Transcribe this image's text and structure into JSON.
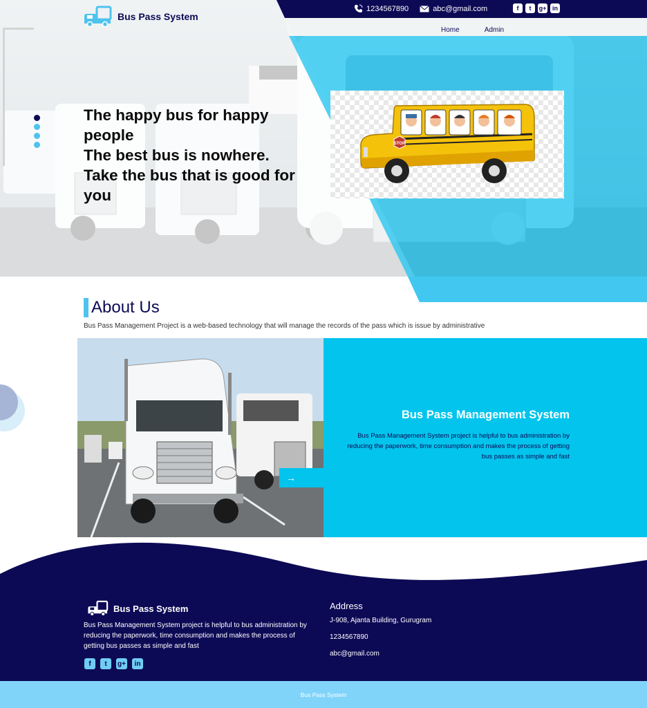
{
  "header": {
    "brand": "Bus Pass System",
    "phone": "1234567890",
    "email": "abc@gmail.com",
    "social_icons": [
      "facebook-icon",
      "twitter-icon",
      "google-plus-icon",
      "linkedin-icon"
    ]
  },
  "nav": {
    "items": [
      {
        "label": "Home"
      },
      {
        "label": "Admin"
      }
    ]
  },
  "hero": {
    "line1": "The happy bus for happy people",
    "line2": "The best bus is nowhere.",
    "line3": "Take the bus that is good for you",
    "slides": 4,
    "active_slide": 1
  },
  "about": {
    "title": "About Us",
    "description": "Bus Pass Management Project is a web-based technology that will manage the records of the pass which is issue by administrative"
  },
  "feature": {
    "title": "Bus Pass Management System",
    "description": "Bus Pass Management System project is helpful to bus administration by reducing the paperwork, time consumption and makes the process of getting bus passes as simple and fast",
    "arrow": "→"
  },
  "footer": {
    "brand": "Bus Pass System",
    "description": "Bus Pass Management System project is helpful to bus administration by reducing the paperwork, time consumption and makes the process of getting bus passes as simple and fast",
    "address_title": "Address",
    "address": "J-908, Ajanta Building, Gurugram",
    "phone": "1234567890",
    "email": "abc@gmail.com",
    "copyright": "Bus Pass System"
  },
  "colors": {
    "navy": "#0d0a55",
    "cyan": "#03c4ed",
    "light_blue": "#81d4f9",
    "bright_blue": "#4fc3ee"
  }
}
